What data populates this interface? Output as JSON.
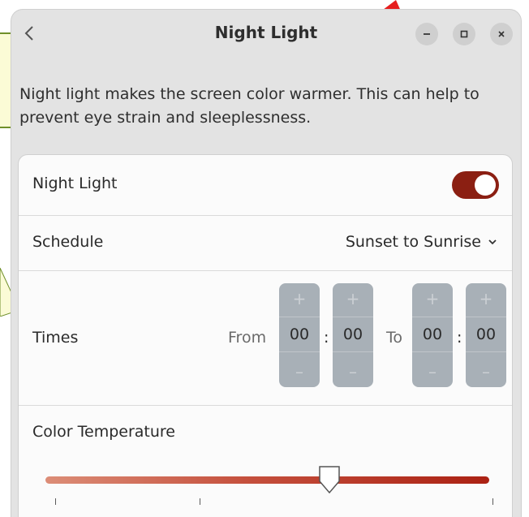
{
  "window": {
    "title": "Night Light",
    "back_icon": "chevron-left-icon",
    "controls": [
      "minimize-icon",
      "maximize-icon",
      "close-icon"
    ]
  },
  "description": "Night light makes the screen color warmer. This can help to prevent eye strain and sleeplessness.",
  "night_light": {
    "label": "Night Light",
    "enabled": true
  },
  "schedule": {
    "label": "Schedule",
    "value": "Sunset to Sunrise"
  },
  "times": {
    "label": "Times",
    "from_label": "From",
    "to_label": "To",
    "separator": ":",
    "plus_symbol": "+",
    "minus_symbol": "–",
    "from_hours": "00",
    "from_minutes": "00",
    "to_hours": "00",
    "to_minutes": "00"
  },
  "color_temperature": {
    "label": "Color Temperature",
    "level": 0.64
  },
  "colors": {
    "accent": "#8b1f12",
    "slider_start": "#dc8d77",
    "slider_end": "#ab2113"
  }
}
